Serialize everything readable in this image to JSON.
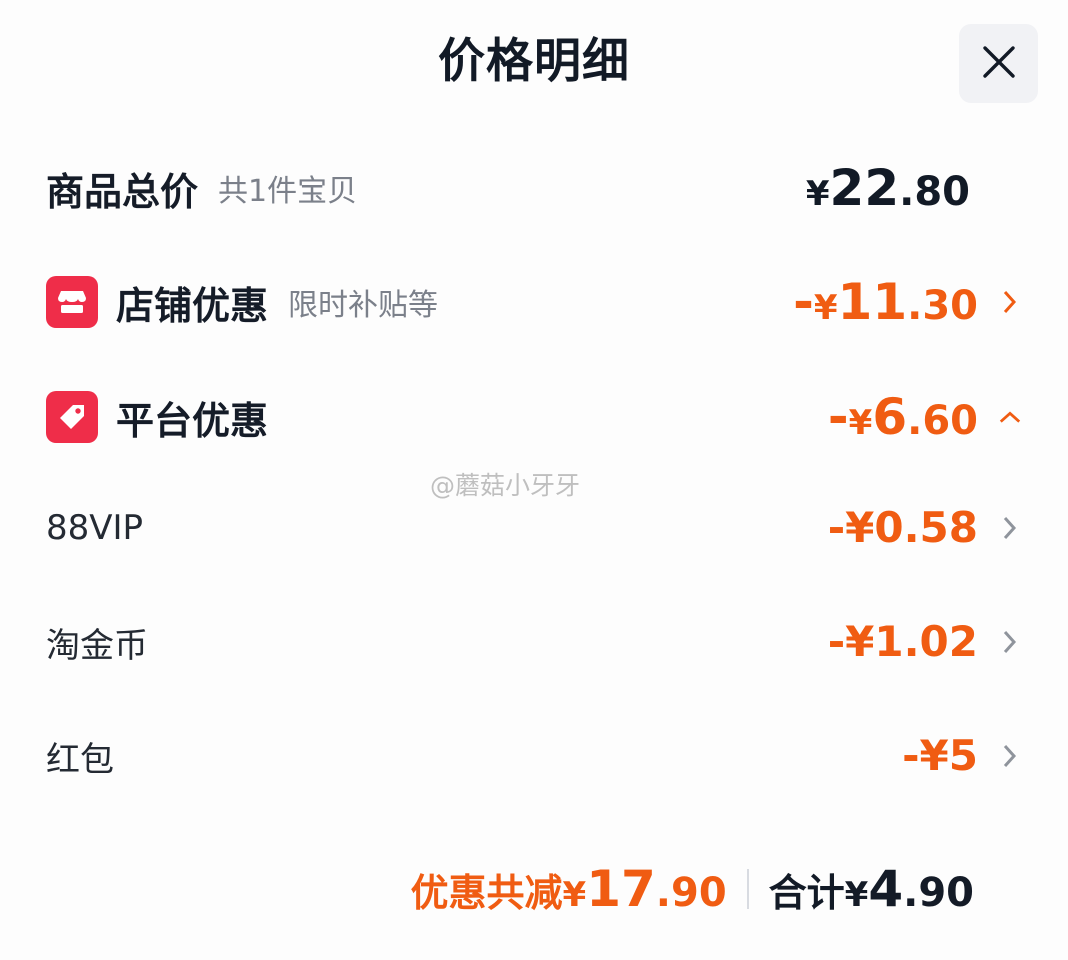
{
  "header": {
    "title": "价格明细",
    "close_icon": "close-icon"
  },
  "rows": {
    "goods": {
      "label": "商品总价",
      "sub": "共1件宝贝",
      "currency": "¥",
      "int": "22",
      "dec": ".80"
    },
    "shop": {
      "label": "店铺优惠",
      "sub": "限时补贴等",
      "icon": "shop-icon",
      "sign": "-",
      "currency": "¥",
      "int": "11",
      "dec": ".30",
      "chevron": "chevron-right-icon"
    },
    "platform": {
      "label": "平台优惠",
      "icon": "tag-icon",
      "sign": "-",
      "currency": "¥",
      "int": "6",
      "dec": ".60",
      "chevron": "chevron-up-icon"
    },
    "vip": {
      "label": "88VIP",
      "value": "-¥0.58",
      "chevron": "chevron-right-icon"
    },
    "coin": {
      "label": "淘金币",
      "value": "-¥1.02",
      "chevron": "chevron-right-icon"
    },
    "redpacket": {
      "label": "红包",
      "value": "-¥5",
      "chevron": "chevron-right-icon"
    }
  },
  "summary": {
    "discount_label": "优惠共减",
    "discount_currency": "¥",
    "discount_int": "17",
    "discount_dec": ".90",
    "total_label": "合计",
    "total_currency": "¥",
    "total_int": "4",
    "total_dec": ".90"
  },
  "watermark": "@蘑菇小牙牙",
  "colors": {
    "accent": "#f05c12",
    "badge": "#ef2d49",
    "text": "#151c28",
    "muted": "#7b808a"
  }
}
